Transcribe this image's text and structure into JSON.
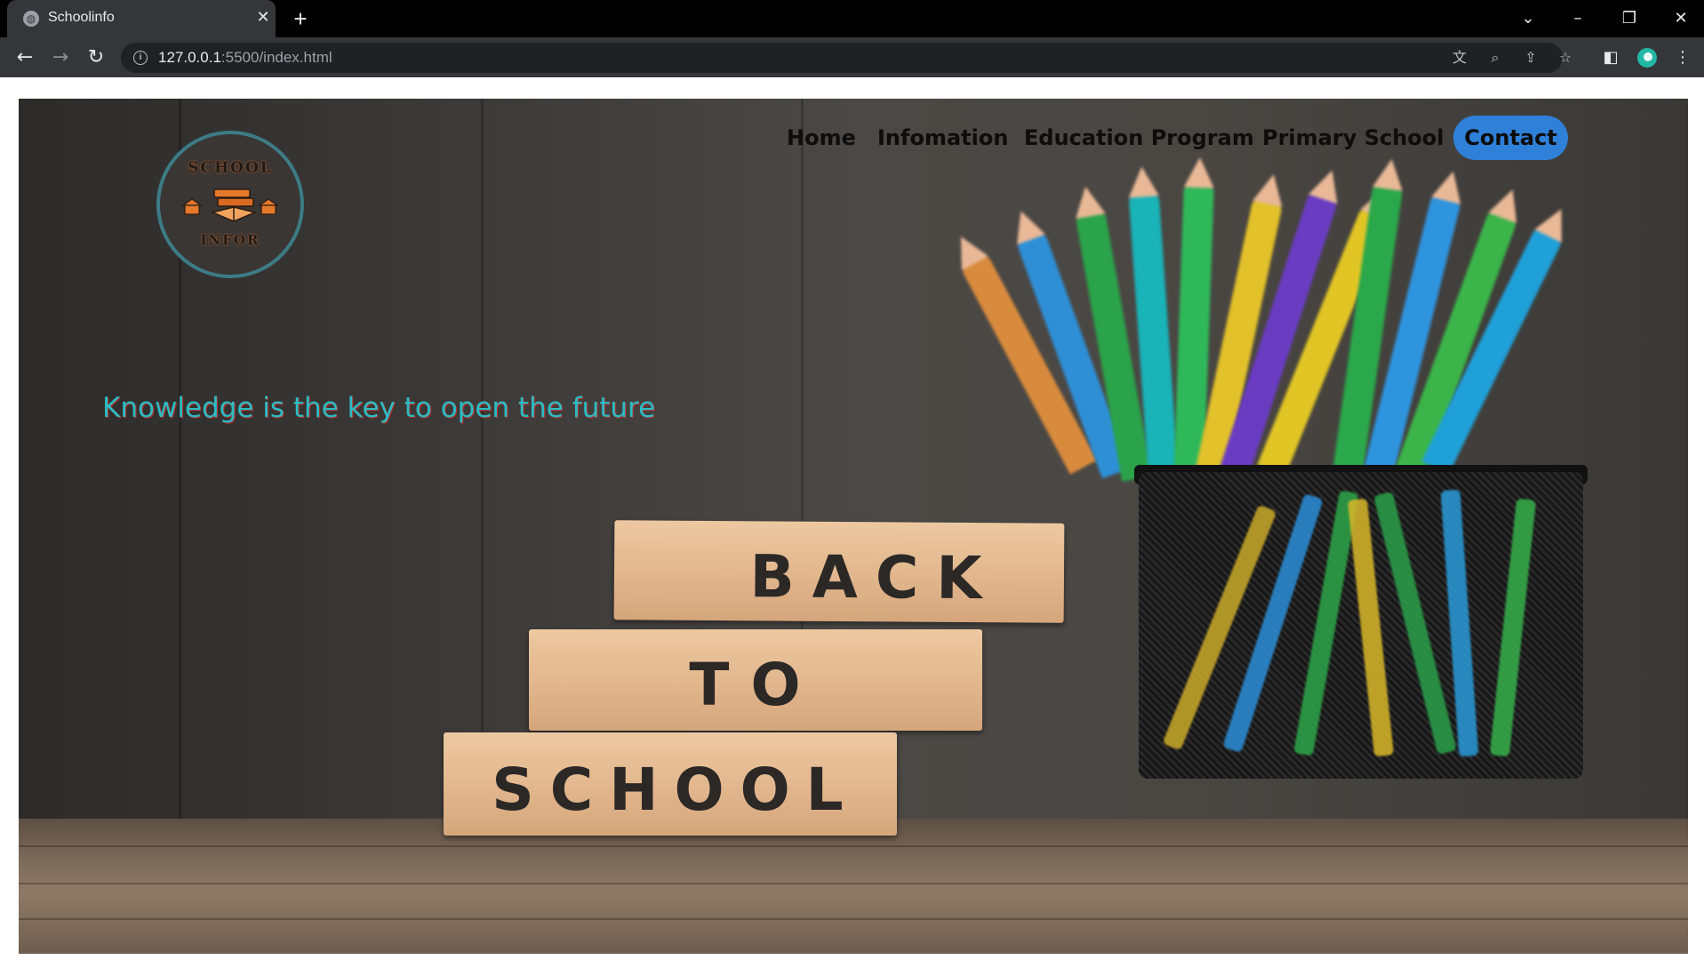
{
  "browser": {
    "tab_title": "Schoolinfo",
    "url_host": "127.0.0.1",
    "url_path": ":5500/index.html",
    "accent": "#35363a"
  },
  "site": {
    "logo": {
      "top_text": "SCHOOL",
      "bottom_text": "INFOR"
    },
    "nav": [
      {
        "label": "Home"
      },
      {
        "label": "Infomation"
      },
      {
        "label": "Education Program"
      },
      {
        "label": "Primary School"
      }
    ],
    "contact_label": "Contact",
    "contact_color": "#2f80d8",
    "tagline": "Knowledge is the key to open the future",
    "tagline_color": "#2bbcc4",
    "blocks": [
      {
        "text": "BACK"
      },
      {
        "text": "TO"
      },
      {
        "text": "SCHOOL"
      }
    ]
  }
}
